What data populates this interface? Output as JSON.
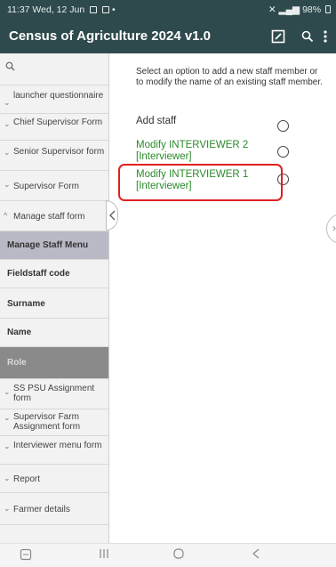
{
  "status_bar": {
    "time_date": "11:37  Wed, 12 Jun",
    "extra": "•",
    "battery": "98%"
  },
  "app_bar": {
    "title": "Census of Agriculture 2024 v1.0",
    "icons": [
      "edit-icon",
      "search-icon",
      "overflow-menu-icon"
    ]
  },
  "sidebar": {
    "items": [
      {
        "label": "",
        "icon": "search-icon"
      },
      {
        "label": "launcher questionnaire",
        "chevron": "down"
      },
      {
        "label": "Chief Supervisor Form",
        "chevron": "down"
      },
      {
        "label": "Senior Supervisor form",
        "chevron": "down"
      },
      {
        "label": "Supervisor Form",
        "chevron": "down"
      },
      {
        "label": "Manage staff form",
        "chevron": "up"
      },
      {
        "label": "Manage Staff Menu"
      },
      {
        "label": "Fieldstaff code"
      },
      {
        "label": "Surname"
      },
      {
        "label": "Name"
      },
      {
        "label": "Role"
      },
      {
        "label": "SS PSU Assignment form",
        "chevron": "down"
      },
      {
        "label": "Supervisor Farm Assignment form",
        "chevron": "down"
      },
      {
        "label": "Interviewer menu form",
        "chevron": "down"
      },
      {
        "label": "Report",
        "chevron": "down"
      },
      {
        "label": "Farmer details",
        "chevron": "down"
      }
    ]
  },
  "main": {
    "instruction": "Select an option to add a new staff member or to modify the name of an existing staff member.",
    "options": [
      {
        "label": "Add staff",
        "selected": false
      },
      {
        "label": "Modify INTERVIEWER 2 [Interviewer]",
        "selected": false
      },
      {
        "label": "Modify INTERVIEWER 1 [Interviewer]",
        "selected": false,
        "highlighted": true
      }
    ],
    "colors": {
      "option_green": "#2a8a2a",
      "highlight": "#e02020",
      "app_bar": "#2f4a4c"
    }
  },
  "nav_bar": {
    "buttons": [
      "screenshot-icon",
      "recents-icon",
      "home-icon",
      "back-icon"
    ]
  }
}
